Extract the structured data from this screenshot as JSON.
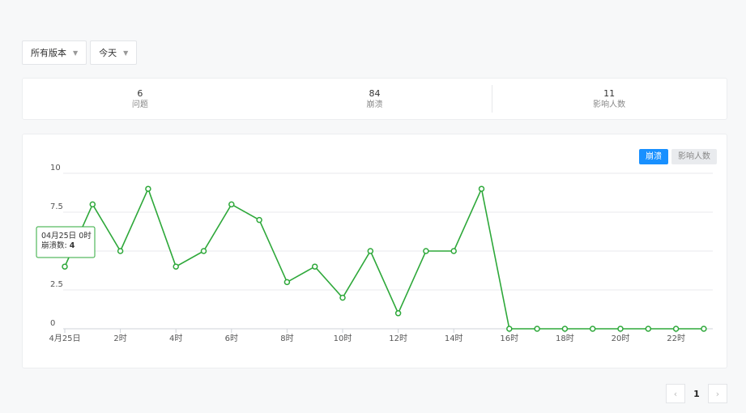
{
  "filters": {
    "version": "所有版本",
    "date": "今天"
  },
  "stats": [
    {
      "value": "6",
      "label": "问题"
    },
    {
      "value": "84",
      "label": "崩溃"
    },
    {
      "value": "11",
      "label": "影响人数"
    }
  ],
  "toggle": {
    "crash": "崩溃",
    "affected": "影响人数"
  },
  "tooltip": {
    "title": "04月25日 0时",
    "label": "崩溃数:",
    "value": "4"
  },
  "pagination": {
    "current": "1"
  },
  "colors": {
    "line": "#2ea83a",
    "accent": "#1890ff"
  },
  "chart_data": {
    "type": "line",
    "x": [
      "4月25日",
      "1时",
      "2时",
      "3时",
      "4时",
      "5时",
      "6时",
      "7时",
      "8时",
      "9时",
      "10时",
      "11时",
      "12时",
      "13时",
      "14时",
      "15时",
      "16时",
      "17时",
      "18时",
      "19时",
      "20时",
      "21时",
      "22时",
      "23时"
    ],
    "tick_labels": [
      "4月25日",
      "",
      "2时",
      "",
      "4时",
      "",
      "6时",
      "",
      "8时",
      "",
      "10时",
      "",
      "12时",
      "",
      "14时",
      "",
      "16时",
      "",
      "18时",
      "",
      "20时",
      "",
      "22时",
      ""
    ],
    "series": [
      {
        "name": "崩溃",
        "values": [
          4,
          8,
          5,
          9,
          4,
          5,
          8,
          7,
          3,
          4,
          2,
          5,
          1,
          5,
          5,
          9,
          0,
          0,
          0,
          0,
          0,
          0,
          0,
          0
        ]
      }
    ],
    "ylim": [
      0,
      10
    ],
    "yticks": [
      "0",
      "2.5",
      "5",
      "7.5",
      "10"
    ],
    "ytick_values": [
      0,
      2.5,
      5,
      7.5,
      10
    ],
    "grid": true
  }
}
